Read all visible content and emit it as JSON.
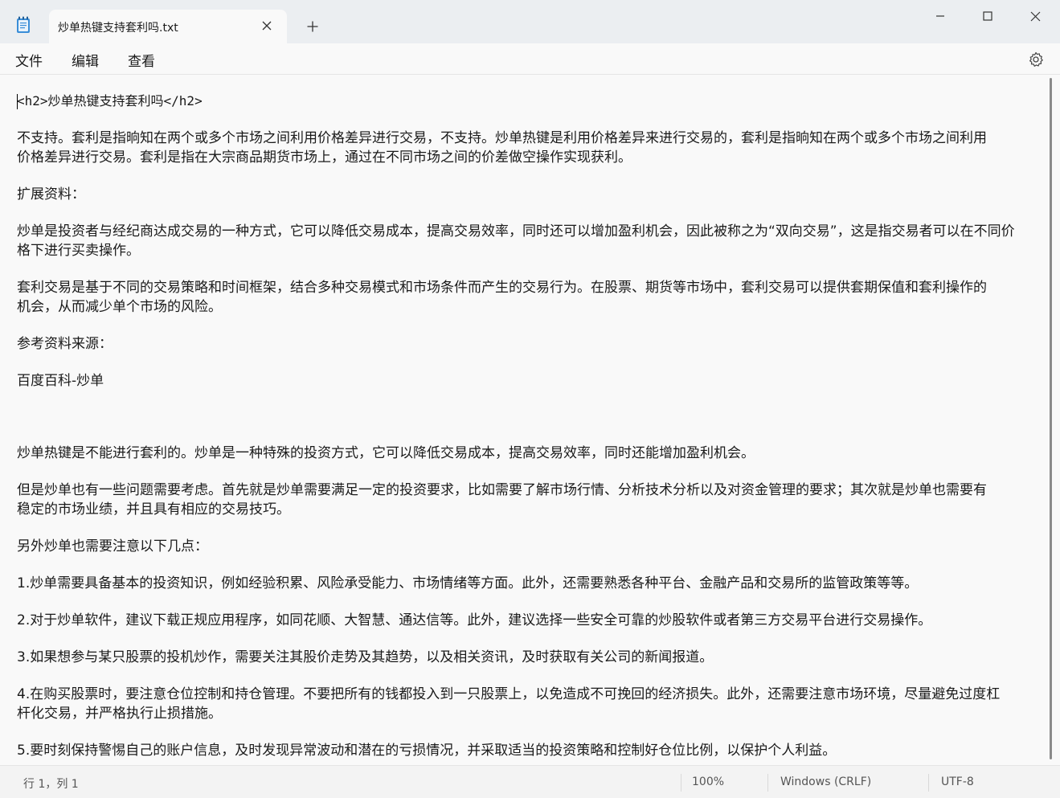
{
  "window": {
    "tab_title": "炒单热键支持套利吗.txt",
    "icon_names": [
      "notepad-icon",
      "close-icon",
      "plus-icon",
      "minimize-icon",
      "maximize-icon",
      "window-close-icon",
      "gear-icon"
    ]
  },
  "menu": {
    "file": "文件",
    "edit": "编辑",
    "view": "查看"
  },
  "editor": {
    "lines": [
      "<h2>炒单热键支持套利吗</h2>",
      "不支持。套利是指晌知在两个或多个市场之间利用价格差异进行交易，不支持。炒单热键是利用价格差异来进行交易的，套利是指晌知在两个或多个市场之间利用",
      "价格差异进行交易。套利是指在大宗商品期货市场上，通过在不同市场之间的价差做空操作实现获利。",
      "扩展资料：",
      "炒单是投资者与经纪商达成交易的一种方式，它可以降低交易成本，提高交易效率，同时还可以增加盈利机会，因此被称之为“双向交易”，这是指交易者可以在不同价",
      "格下进行买卖操作。",
      "套利交易是基于不同的交易策略和时间框架，结合多种交易模式和市场条件而产生的交易行为。在股票、期货等市场中，套利交易可以提供套期保值和套利操作的",
      "机会，从而减少单个市场的风险。",
      "参考资料来源：",
      "百度百科-炒单",
      "炒单热键是不能进行套利的。炒单是一种特殊的投资方式，它可以降低交易成本，提高交易效率，同时还能增加盈利机会。",
      "但是炒单也有一些问题需要考虑。首先就是炒单需要满足一定的投资要求，比如需要了解市场行情、分析技术分析以及对资金管理的要求；其次就是炒单也需要有",
      "稳定的市场业绩，并且具有相应的交易技巧。",
      "另外炒单也需要注意以下几点：",
      "1.炒单需要具备基本的投资知识，例如经验积累、风险承受能力、市场情绪等方面。此外，还需要熟悉各种平台、金融产品和交易所的监管政策等等。",
      "2.对于炒单软件，建议下载正规应用程序，如同花顺、大智慧、通达信等。此外，建议选择一些安全可靠的炒股软件或者第三方交易平台进行交易操作。",
      "3.如果想参与某只股票的投机炒作，需要关注其股价走势及其趋势，以及相关资讯，及时获取有关公司的新闻报道。",
      "4.在购买股票时，要注意仓位控制和持仓管理。不要把所有的钱都投入到一只股票上，以免造成不可挽回的经济损失。此外，还需要注意市场环境，尽量避免过度杠",
      "杆化交易，并严格执行止损措施。",
      "5.要时刻保持警惕自己的账户信息，及时发现异常波动和潜在的亏损情况，并采取适当的投资策略和控制好仓位比例，以保护个人利益。"
    ]
  },
  "status": {
    "position": "行 1，列 1",
    "zoom": "100%",
    "line_ending": "Windows (CRLF)",
    "encoding": "UTF-8"
  }
}
